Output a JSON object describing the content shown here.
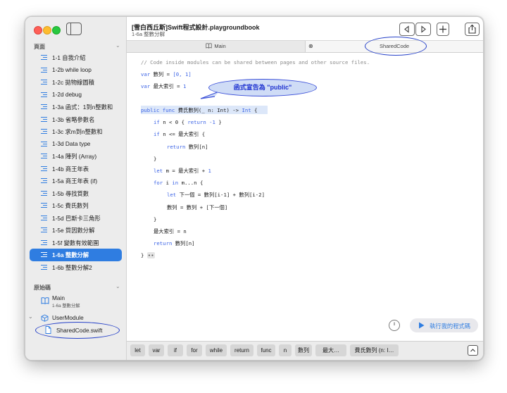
{
  "colors": {
    "accent": "#2f7de1",
    "keyword": "#3c64e6",
    "comment": "#8a8a8a",
    "annotation": "#1e32d0"
  },
  "sidebar": {
    "pages_header": "頁面",
    "pages": [
      {
        "label": "1-1 自我介紹"
      },
      {
        "label": "1-2b while loop"
      },
      {
        "label": "1-2c 拋物線圖積"
      },
      {
        "label": "1-2d debug"
      },
      {
        "label": "1-3a 函式：1到n整數和"
      },
      {
        "label": "1-3b 省略參數名"
      },
      {
        "label": "1-3c 求m到n整數和"
      },
      {
        "label": "1-3d Data type"
      },
      {
        "label": "1-4a 陣列 (Array)"
      },
      {
        "label": "1-4b 商王年表"
      },
      {
        "label": "1-5a 商王年表 (if)"
      },
      {
        "label": "1-5b 尋找質數"
      },
      {
        "label": "1-5c 費氏數列"
      },
      {
        "label": "1-5d 巴斯卡三角形"
      },
      {
        "label": "1-5e 質因數分解"
      },
      {
        "label": "1-5f 變數有效範圍"
      },
      {
        "label": "1-6a 整數分解"
      },
      {
        "label": "1-6b 整數分解2"
      }
    ],
    "source_header": "原始碼",
    "main_item": {
      "label": "Main",
      "sublabel": "1-6a 整數分解"
    },
    "module_label": "UserModule",
    "file_label": "SharedCode.swift"
  },
  "header": {
    "title": "[雪白西丘斯]Swift程式設計.playgroundbook",
    "subtitle": "1-6a 整數分解"
  },
  "tabs": {
    "main": "Main",
    "shared": "SharedCode"
  },
  "code": {
    "comment": "// Code inside modules can be shared between pages and other source files.",
    "array_name": "數列",
    "array_literal": "[0, 1]",
    "max_index_name": "最大索引",
    "max_index_value": "1",
    "func_name": "費氏數列",
    "param": "_ n: Int",
    "ret_type": "Int",
    "guard_cond": "n < 0",
    "guard_value": "-1",
    "if_cond": "n <= 最大索引",
    "return1": "數列[n]",
    "let_m_expr": "最大索引",
    "let_m_add": "1",
    "loop_range": "m...n",
    "next_name": "下一個",
    "next_expr": "數列[i-1] + 數列[i-2]",
    "append_stmt": "數列 = 數列 + [下一個]",
    "assign_stmt": "最大索引 = n",
    "return2": "數列[n]"
  },
  "annotation": "函式宣告為 \"public\"",
  "run_button": "執行我的程式碼",
  "shortcuts": [
    "let",
    "var",
    "if",
    "for",
    "while",
    "return",
    "func",
    "n",
    "數列",
    "最大…",
    "費氏數列 (n: I…"
  ]
}
